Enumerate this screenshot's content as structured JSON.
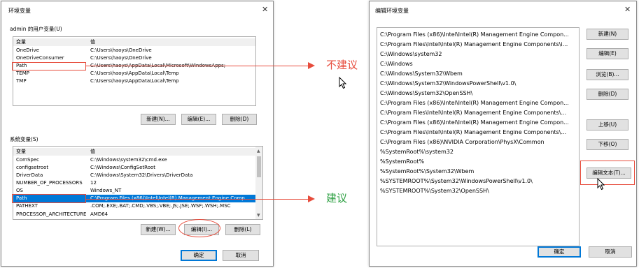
{
  "left_dialog": {
    "title": "环境变量",
    "close": "✕",
    "user_vars_label": "admin 的用户变量(U)",
    "user_vars": {
      "headers": [
        "变量",
        "值"
      ],
      "rows": [
        [
          "OneDrive",
          "C:\\Users\\haoys\\OneDrive"
        ],
        [
          "OneDriveConsumer",
          "C:\\Users\\haoys\\OneDrive"
        ],
        [
          "Path",
          "C:\\Users\\haoys\\AppData\\Local\\Microsoft\\WindowsApps;"
        ],
        [
          "TEMP",
          "C:\\Users\\haoys\\AppData\\Local\\Temp"
        ],
        [
          "TMP",
          "C:\\Users\\haoys\\AppData\\Local\\Temp"
        ]
      ]
    },
    "user_buttons": {
      "new": "新建(N)...",
      "edit": "编辑(E)...",
      "delete": "删除(D)"
    },
    "sys_vars_label": "系统变量(S)",
    "sys_vars": {
      "headers": [
        "变量",
        "值"
      ],
      "rows": [
        [
          "ComSpec",
          "C:\\Windows\\system32\\cmd.exe"
        ],
        [
          "configsetroot",
          "C:\\Windows\\ConfigSetRoot"
        ],
        [
          "DriverData",
          "C:\\Windows\\System32\\Drivers\\DriverData"
        ],
        [
          "NUMBER_OF_PROCESSORS",
          "12"
        ],
        [
          "OS",
          "Windows_NT"
        ],
        [
          "Path",
          "C:\\Program Files (x86)\\Intel\\Intel(R) Management Engine Comp..."
        ],
        [
          "PATHEXT",
          ".COM;.EXE;.BAT;.CMD;.VBS;.VBE;.JS;.JSE;.WSF;.WSH;.MSC"
        ],
        [
          "PROCESSOR_ARCHITECTURE",
          "AMD64"
        ]
      ],
      "selected_index": 5
    },
    "sys_buttons": {
      "new": "新建(W)...",
      "edit": "编辑(I)...",
      "delete": "删除(L)"
    },
    "ok": "确定",
    "cancel": "取消"
  },
  "right_dialog": {
    "title": "编辑环境变量",
    "close": "✕",
    "path_entries": [
      "C:\\Program Files (x86)\\Intel\\Intel(R) Management Engine Compon...",
      "C:\\Program Files\\Intel\\Intel(R) Management Engine Components\\i...",
      "C:\\Windows\\system32",
      "C:\\Windows",
      "C:\\Windows\\System32\\Wbem",
      "C:\\Windows\\System32\\WindowsPowerShell\\v1.0\\",
      "C:\\Windows\\System32\\OpenSSH\\",
      "C:\\Program Files (x86)\\Intel\\Intel(R) Management Engine Compon...",
      "C:\\Program Files\\Intel\\Intel(R) Management Engine Components\\...",
      "C:\\Program Files (x86)\\Intel\\Intel(R) Management Engine Compon...",
      "C:\\Program Files\\Intel\\Intel(R) Management Engine Components\\...",
      "C:\\Program Files (x86)\\NVIDIA Corporation\\PhysX\\Common",
      "%SystemRoot%\\system32",
      "%SystemRoot%",
      "%SystemRoot%\\System32\\Wbem",
      "%SYSTEMROOT%\\System32\\WindowsPowerShell\\v1.0\\",
      "%SYSTEMROOT%\\System32\\OpenSSH\\"
    ],
    "buttons": {
      "new": "新建(N)",
      "edit": "编辑(E)",
      "browse": "浏览(B)...",
      "delete": "删除(D)",
      "move_up": "上移(U)",
      "move_down": "下移(O)",
      "edit_text": "编辑文本(T)..."
    },
    "ok": "确定",
    "cancel": "取消"
  },
  "annotations": {
    "not_recommended": "不建议",
    "recommended": "建议",
    "not_recommended_color": "#e74c3c",
    "recommended_color": "#2ea043"
  }
}
